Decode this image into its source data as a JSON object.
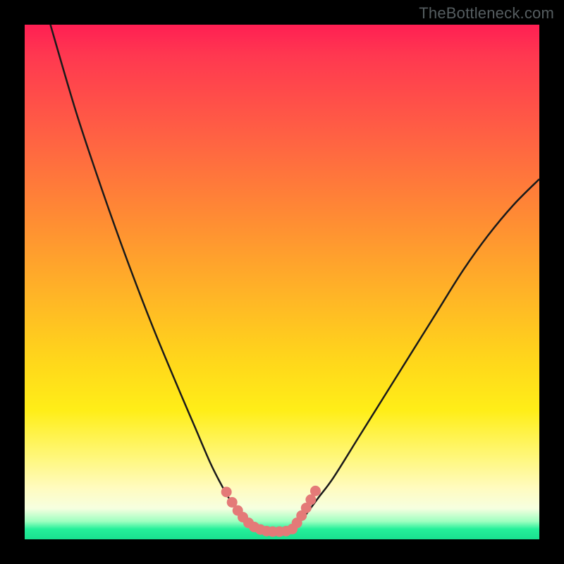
{
  "watermark": "TheBottleneck.com",
  "colors": {
    "curve_stroke": "#1a1a1a",
    "marker_fill": "#e47a78",
    "frame_bg": "#000000"
  },
  "chart_data": {
    "type": "line",
    "title": "",
    "xlabel": "",
    "ylabel": "",
    "xlim": [
      0,
      100
    ],
    "ylim": [
      0,
      100
    ],
    "grid": false,
    "legend": false,
    "series": [
      {
        "name": "left-branch",
        "x": [
          5,
          10,
          15,
          20,
          25,
          30,
          33,
          36,
          38,
          40,
          42,
          44,
          46
        ],
        "y": [
          100,
          83,
          68,
          54,
          41,
          29,
          22,
          15,
          11,
          7.5,
          5,
          3,
          2
        ]
      },
      {
        "name": "right-branch",
        "x": [
          52,
          54,
          57,
          60,
          65,
          70,
          75,
          80,
          85,
          90,
          95,
          100
        ],
        "y": [
          2,
          4,
          8,
          12,
          20,
          28,
          36,
          44,
          52,
          59,
          65,
          70
        ]
      },
      {
        "name": "floor",
        "x": [
          46,
          48,
          50,
          52
        ],
        "y": [
          2,
          1.5,
          1.5,
          2
        ]
      }
    ],
    "markers": {
      "name": "highlight-dots",
      "points": [
        {
          "x": 39.2,
          "y": 9.2
        },
        {
          "x": 40.3,
          "y": 7.2
        },
        {
          "x": 41.4,
          "y": 5.6
        },
        {
          "x": 42.4,
          "y": 4.3
        },
        {
          "x": 43.5,
          "y": 3.2
        },
        {
          "x": 44.6,
          "y": 2.4
        },
        {
          "x": 45.8,
          "y": 1.9
        },
        {
          "x": 47.0,
          "y": 1.6
        },
        {
          "x": 48.2,
          "y": 1.5
        },
        {
          "x": 49.5,
          "y": 1.5
        },
        {
          "x": 50.8,
          "y": 1.6
        },
        {
          "x": 52.0,
          "y": 2.0
        },
        {
          "x": 52.9,
          "y": 3.2
        },
        {
          "x": 53.8,
          "y": 4.6
        },
        {
          "x": 54.7,
          "y": 6.1
        },
        {
          "x": 55.6,
          "y": 7.7
        },
        {
          "x": 56.5,
          "y": 9.4
        }
      ]
    }
  }
}
